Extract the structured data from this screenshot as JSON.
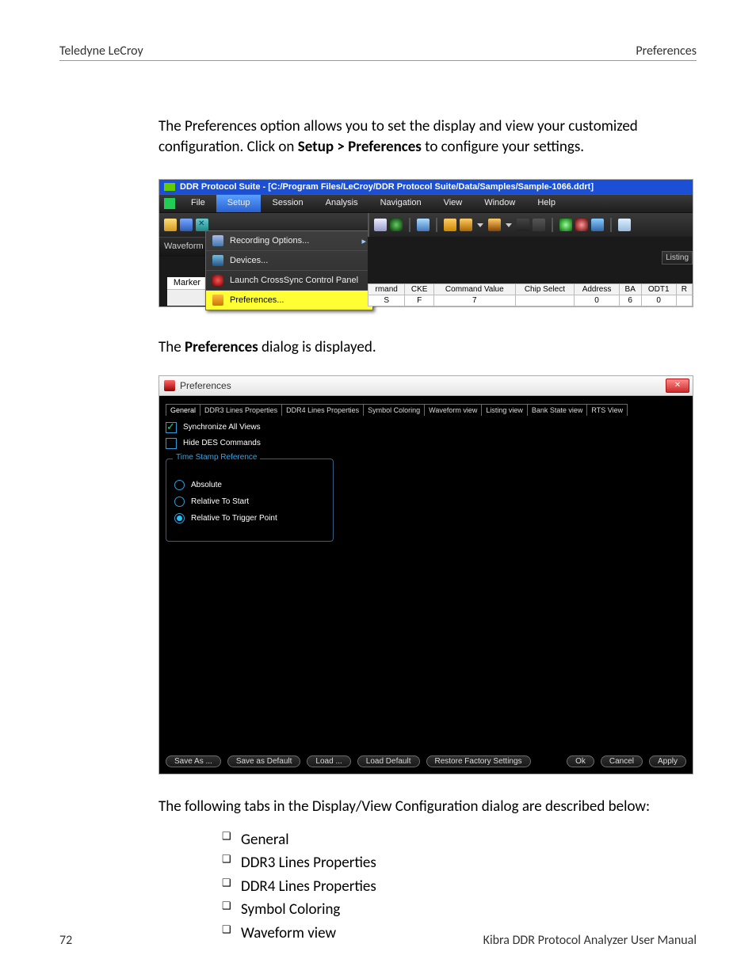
{
  "header": {
    "left": "Teledyne LeCroy",
    "right": "Preferences"
  },
  "para1_a": "The Preferences option allows you to set the display and view your customized configuration. Click on ",
  "para1_b": "Setup > Preferences",
  "para1_c": " to configure your settings.",
  "fig1": {
    "title": "DDR Protocol Suite - [C:/Program Files/LeCroy/DDR Protocol Suite/Data/Samples/Sample-1066.ddrt]",
    "menus": [
      "File",
      "Setup",
      "Session",
      "Analysis",
      "Navigation",
      "View",
      "Window",
      "Help"
    ],
    "active_menu_index": 1,
    "waveform_label": "Waveform Vi",
    "marker_label": "Marker",
    "dropdown": {
      "items": [
        {
          "label": "Recording Options...",
          "has_submenu": true
        },
        {
          "label": "Devices..."
        },
        {
          "label": "Launch CrossSync Control Panel"
        },
        {
          "label": "Preferences...",
          "highlight": true
        }
      ]
    },
    "listing_label": "Listing",
    "table": {
      "headers": [
        "rmand",
        "CKE",
        "Command Value",
        "Chip Select",
        "Address",
        "BA",
        "ODT1",
        "R"
      ],
      "row": [
        "S",
        "F",
        "7",
        "",
        "0",
        "6",
        "0",
        ""
      ]
    }
  },
  "para2_a": "The ",
  "para2_b": "Preferences",
  "para2_c": " dialog is displayed.",
  "fig2": {
    "title": "Preferences",
    "tabs": [
      "General",
      "DDR3 Lines Properties",
      "DDR4 Lines Properties",
      "Symbol Coloring",
      "Waveform view",
      "Listing view",
      "Bank State view",
      "RTS View"
    ],
    "active_tab_index": 0,
    "checks": [
      {
        "label": "Synchronize All Views",
        "checked": true
      },
      {
        "label": "Hide DES Commands",
        "checked": false
      }
    ],
    "group_title": "Time Stamp Reference",
    "radios": [
      {
        "label": "Absolute",
        "selected": false
      },
      {
        "label": "Relative To Start",
        "selected": false
      },
      {
        "label": "Relative To Trigger Point",
        "selected": true
      }
    ],
    "buttons_left": [
      "Save As ...",
      "Save as Default",
      "Load ...",
      "Load Default",
      "Restore Factory Settings"
    ],
    "buttons_right": [
      "Ok",
      "Cancel",
      "Apply"
    ]
  },
  "para3": "The following tabs in the Display/View Configuration dialog are described below:",
  "bullets": [
    "General",
    "DDR3 Lines Properties",
    "DDR4 Lines Properties",
    "Symbol Coloring",
    "Waveform view"
  ],
  "footer": {
    "left": "72",
    "right": "Kibra DDR Protocol Analyzer User Manual"
  }
}
